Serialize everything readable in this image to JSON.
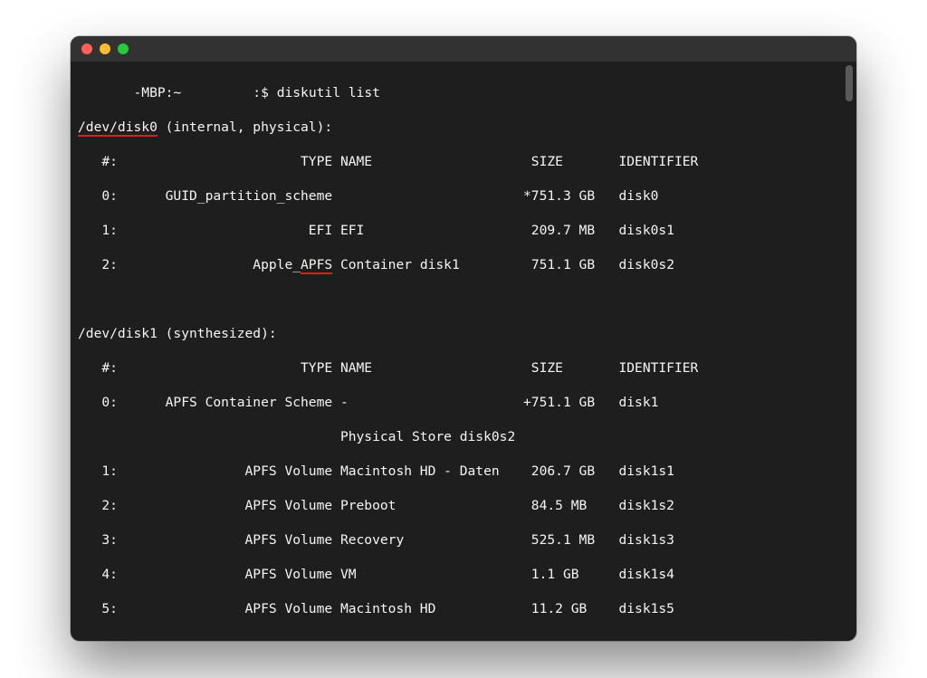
{
  "prompt": {
    "host_prefix": "       -MBP:~",
    "user_marker": "         :$",
    "command": "diskutil list"
  },
  "disk0": {
    "header_name": "/dev/disk0",
    "header_rest": " (internal, physical):",
    "columns": "   #:                       TYPE NAME                    SIZE       IDENTIFIER",
    "rows": [
      "   0:      GUID_partition_scheme                        *751.3 GB   disk0",
      "   1:                        EFI EFI                     209.7 MB   disk0s1"
    ],
    "row2_pre": "   2:                 Apple_",
    "row2_apfs": "APFS",
    "row2_post": " Container disk1         751.1 GB   disk0s2"
  },
  "disk1": {
    "header": "/dev/disk1 (synthesized):",
    "columns": "   #:                       TYPE NAME                    SIZE       IDENTIFIER",
    "rows": [
      "   0:      APFS Container Scheme -                      +751.1 GB   disk1",
      "                                 Physical Store disk0s2",
      "   1:                APFS Volume Macintosh HD - Daten    206.7 GB   disk1s1",
      "   2:                APFS Volume Preboot                 84.5 MB    disk1s2",
      "   3:                APFS Volume Recovery                525.1 MB   disk1s3",
      "   4:                APFS Volume VM                      1.1 GB     disk1s4",
      "   5:                APFS Volume Macintosh HD            11.2 GB    disk1s5"
    ]
  }
}
